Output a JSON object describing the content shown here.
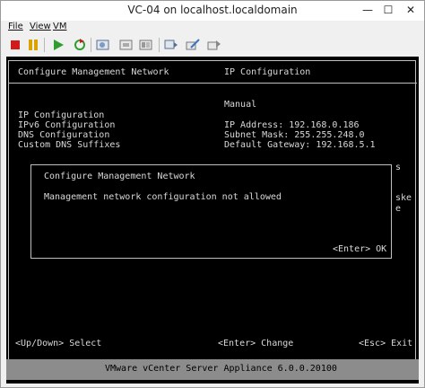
{
  "window": {
    "title": "VC-04 on localhost.localdomain",
    "minimize_glyph": "—",
    "maximize_glyph": "☐",
    "close_glyph": "✕"
  },
  "menu": {
    "file": "File",
    "view": "View",
    "vm": "VM"
  },
  "toolbar": {
    "icons": [
      "stop-icon",
      "pause-icon",
      "play-icon",
      "reset-icon",
      "snapshot-icon",
      "revert-snapshot-icon",
      "manage-snapshot-icon",
      "console-icon",
      "edit-settings-icon",
      "migrate-icon"
    ],
    "colors": {
      "stop": "#d11a1a",
      "play": "#2e9e2e",
      "pause": "#d9a400"
    }
  },
  "console": {
    "header_left": "Configure Management Network",
    "header_right": "IP Configuration",
    "menu_items": [
      "IP Configuration",
      "IPv6 Configuration",
      "DNS Configuration",
      "Custom DNS Suffixes"
    ],
    "ip_mode": "Manual",
    "ip_address": "IP Address: 192.168.0.186",
    "subnet_mask": "Subnet Mask: 255.255.248.0",
    "gateway": "Default Gateway: 192.168.5.1",
    "side_s": "s",
    "side_ske": "ske",
    "side_e": "e",
    "dialog": {
      "title": "Configure Management Network",
      "message": "Management network configuration not allowed",
      "ok": "<Enter> OK"
    },
    "hint_select": "<Up/Down> Select",
    "hint_change": "<Enter> Change",
    "hint_exit": "<Esc> Exit",
    "footer": "VMware vCenter Server Appliance 6.0.0.20100"
  }
}
